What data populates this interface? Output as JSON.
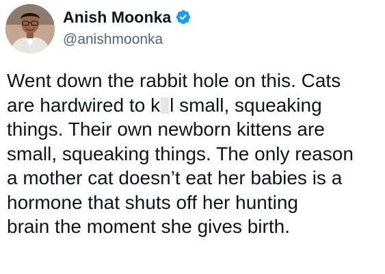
{
  "author": {
    "display_name": "Anish Moonka",
    "handle": "@anishmoonka",
    "verified": true,
    "verified_color": "#1d9bf0",
    "avatar_icon": "profile-photo-man-glasses"
  },
  "tweet": {
    "line1": "Went down the rabbit hole on this. Cats",
    "line2_before": "are hardwired to k",
    "line2_after": "l small, squeaking",
    "line3": "things. Their own newborn kittens are",
    "line4": "small, squeaking things. The only reason",
    "line5": "a mother cat doesn’t eat her babies is a",
    "line6": "hormone that shuts off her hunting",
    "line7": "brain the moment she gives birth."
  },
  "colors": {
    "text": "#0f1419",
    "secondary": "#536471",
    "background": "#ffffff"
  }
}
